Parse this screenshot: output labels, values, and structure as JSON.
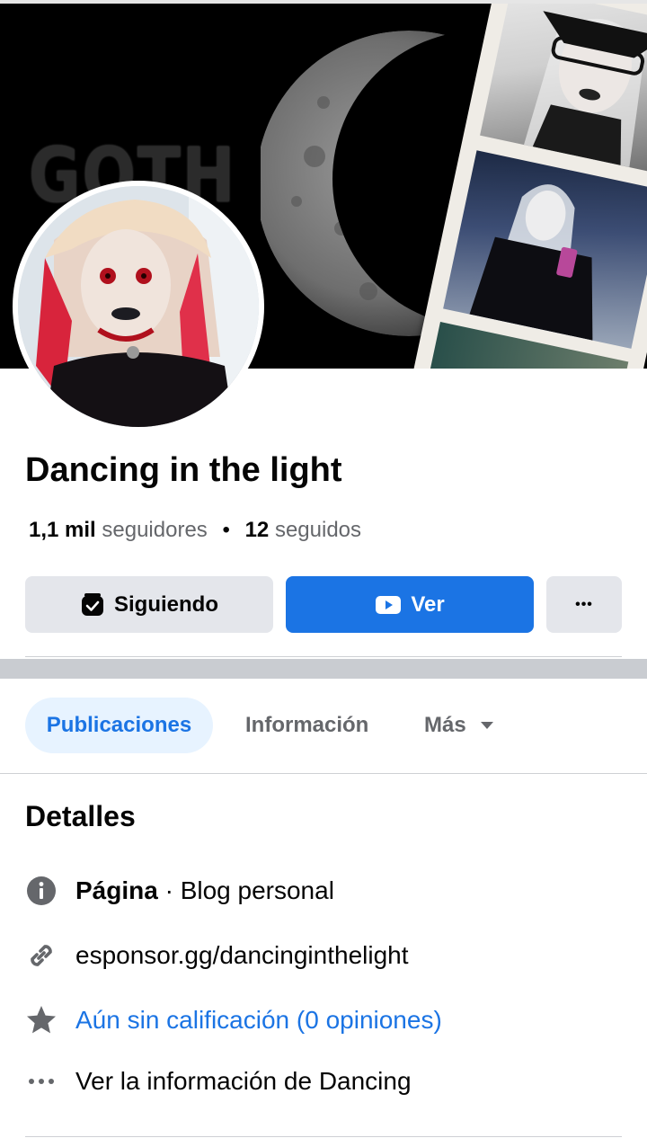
{
  "cover": {
    "overlay_text": "GOTH",
    "icon": "moon-crescent-image"
  },
  "profile": {
    "name": "Dancing in the light",
    "followers_count": "1,1 mil",
    "followers_label": "seguidores",
    "following_count": "12",
    "following_label": "seguidos",
    "separator": "•"
  },
  "actions": {
    "following_label": "Siguiendo",
    "following_icon": "following-check-icon",
    "watch_label": "Ver",
    "watch_icon": "video-play-icon",
    "more_label": "•••",
    "more_icon": "more-dots-icon"
  },
  "tabs": [
    {
      "label": "Publicaciones",
      "active": true
    },
    {
      "label": "Información",
      "active": false
    },
    {
      "label": "Más",
      "active": false,
      "icon": "caret-down-icon"
    }
  ],
  "details": {
    "title": "Detalles",
    "rows": [
      {
        "icon": "info-icon",
        "bold": "Página",
        "text": " · Blog personal"
      },
      {
        "icon": "link-icon",
        "text": "esponsor.gg/dancinginthelight"
      },
      {
        "icon": "star-icon",
        "text": "Aún sin calificación (0 opiniones)",
        "color": "#1b74e4"
      },
      {
        "icon": "more-dots-icon",
        "text": "Ver la información de Dancing"
      }
    ]
  },
  "colors": {
    "accent": "#1b74e4",
    "button_gray": "#e4e6eb",
    "tab_active_bg": "#e7f3ff",
    "secondary_text": "#65676b"
  }
}
